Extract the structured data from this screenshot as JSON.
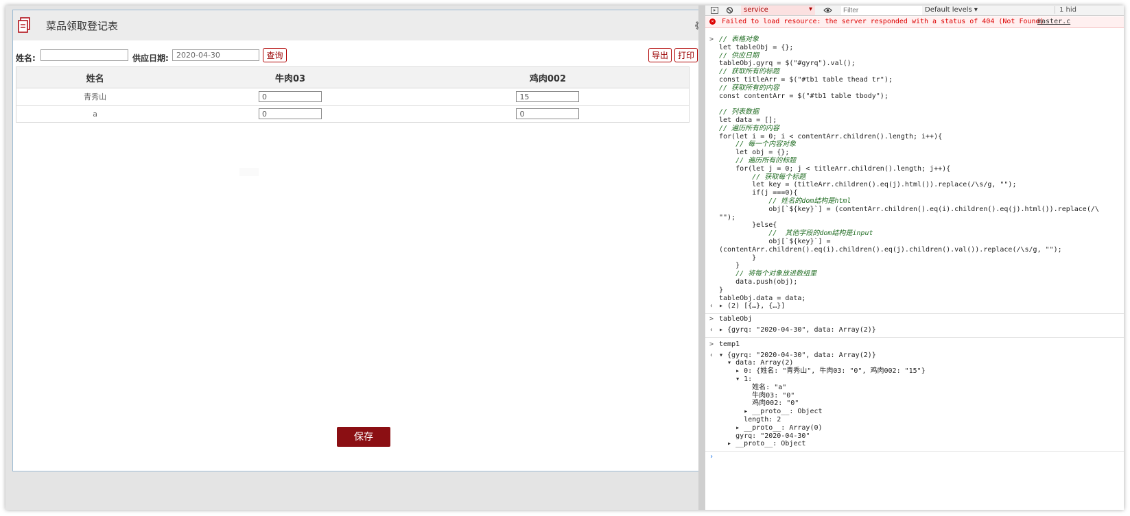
{
  "app": {
    "title": "菜品领取登记表",
    "filter": {
      "name_label": "姓名:",
      "name_value": "",
      "date_label": "供应日期:",
      "date_value": "2020-04-30",
      "query_label": "查询",
      "export_label": "导出",
      "print_label": "打印"
    },
    "table": {
      "headers": [
        "姓名",
        "牛肉03",
        "鸡肉002"
      ],
      "rows": [
        {
          "name": "青秀山",
          "beef": "0",
          "chicken": "15"
        },
        {
          "name": "a",
          "beef": "0",
          "chicken": "0"
        }
      ]
    },
    "save_label": "保存"
  },
  "devtools": {
    "context": "service",
    "filter_placeholder": "Filter",
    "levels": "Default levels ▾",
    "hidden": "1 hid",
    "error": "Failed to load resource: the server responded with a status of 404 (Not Found)",
    "error_source": "master.c",
    "code_lines": [
      {
        "t": "// 表格对象",
        "c": true
      },
      {
        "t": "let tableObj = {};",
        "c": false
      },
      {
        "t": "// 供应日期",
        "c": true
      },
      {
        "t": "tableObj.gyrq = $(\"#gyrq\").val();",
        "c": false
      },
      {
        "t": "// 获取所有的标题",
        "c": true
      },
      {
        "t": "const titleArr = $(\"#tb1 table thead tr\");",
        "c": false
      },
      {
        "t": "// 获取所有的内容",
        "c": true
      },
      {
        "t": "const contentArr = $(\"#tb1 table tbody\");",
        "c": false
      },
      {
        "t": "",
        "c": false
      },
      {
        "t": "// 列表数据",
        "c": true
      },
      {
        "t": "let data = [];",
        "c": false
      },
      {
        "t": "// 遍历所有的内容",
        "c": true
      },
      {
        "t": "for(let i = 0; i < contentArr.children().length; i++){",
        "c": false
      },
      {
        "t": "    // 每一个内容对象",
        "c": true
      },
      {
        "t": "    let obj = {};",
        "c": false
      },
      {
        "t": "    // 遍历所有的标题",
        "c": true
      },
      {
        "t": "    for(let j = 0; j < titleArr.children().length; j++){",
        "c": false
      },
      {
        "t": "        // 获取每个标题",
        "c": true
      },
      {
        "t": "        let key = (titleArr.children().eq(j).html()).replace(/\\s/g, \"\");",
        "c": false
      },
      {
        "t": "        if(j ===0){",
        "c": false
      },
      {
        "t": "            // 姓名的dom结构是html",
        "c": true
      },
      {
        "t": "            obj[`${key}`] = (contentArr.children().eq(i).children().eq(j).html()).replace(/\\",
        "c": false
      },
      {
        "t": "\"\");",
        "c": false
      },
      {
        "t": "        }else{",
        "c": false
      },
      {
        "t": "            //  其他字段的dom结构是input",
        "c": true
      },
      {
        "t": "            obj[`${key}`] =",
        "c": false
      },
      {
        "t": "(contentArr.children().eq(i).children().eq(j).children().val()).replace(/\\s/g, \"\");",
        "c": false
      },
      {
        "t": "        }",
        "c": false
      },
      {
        "t": "    }",
        "c": false
      },
      {
        "t": "    // 将每个对象放进数组里",
        "c": true
      },
      {
        "t": "    data.push(obj);",
        "c": false
      },
      {
        "t": "}",
        "c": false
      },
      {
        "t": "tableObj.data = data;",
        "c": false
      }
    ],
    "result1": "▸ (2) [{…}, {…}]",
    "cmd2": "tableObj",
    "result2": "▸ {gyrq: \"2020-04-30\", data: Array(2)}",
    "cmd3": "temp1",
    "tree": [
      "▾ {gyrq: \"2020-04-30\", data: Array(2)}",
      "  ▾ data: Array(2)",
      "    ▸ 0: {姓名: \"青秀山\", 牛肉03: \"0\", 鸡肉002: \"15\"}",
      "    ▾ 1:",
      "        姓名: \"a\"",
      "        牛肉03: \"0\"",
      "        鸡肉002: \"0\"",
      "      ▸ __proto__: Object",
      "      length: 2",
      "    ▸ __proto__: Array(0)",
      "    gyrq: \"2020-04-30\"",
      "  ▸ __proto__: Object"
    ]
  }
}
